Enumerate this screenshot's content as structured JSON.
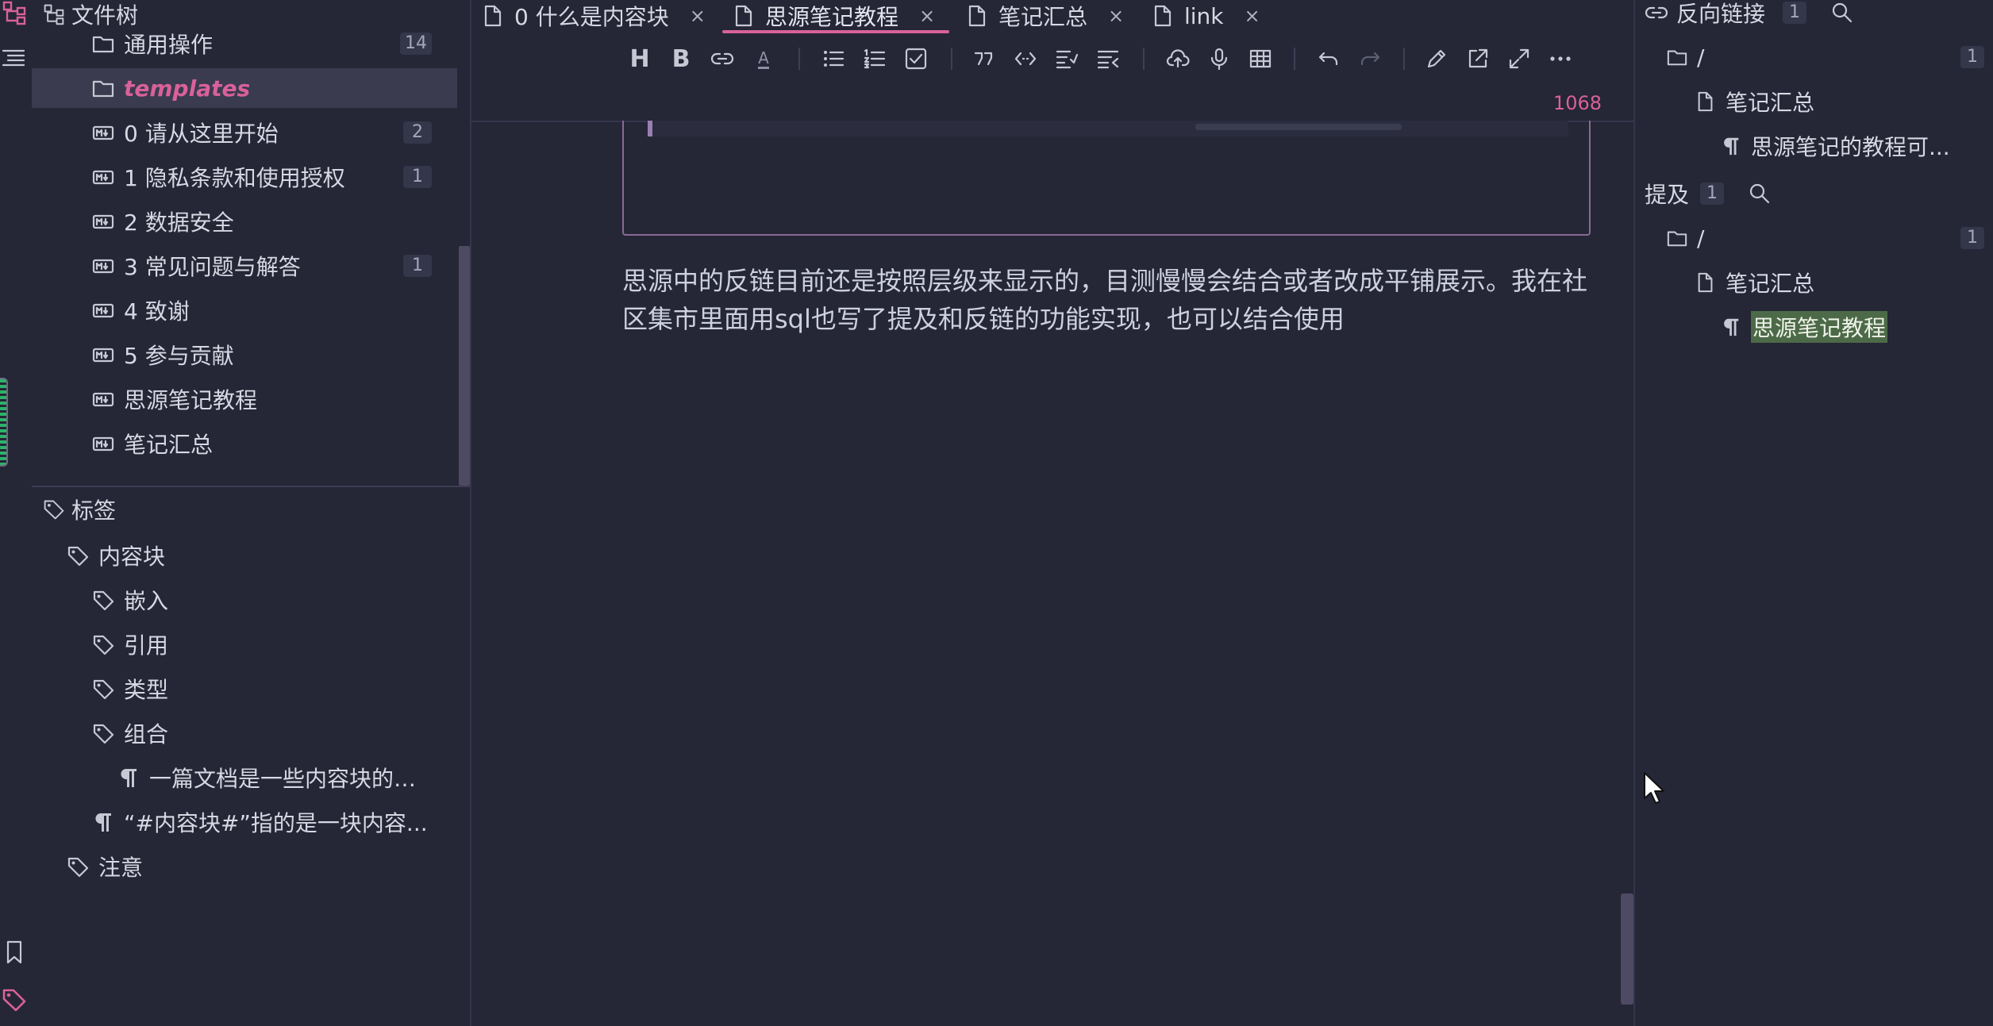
{
  "left_panel": {
    "file_tree_title": "文件树",
    "files": [
      {
        "label": "通用操作",
        "count": "14",
        "icon": "folder-icon"
      },
      {
        "label": "templates",
        "count": "",
        "icon": "folder-icon",
        "selected": true
      },
      {
        "label": "0 请从这里开始",
        "count": "2",
        "icon": "markdown-doc-icon"
      },
      {
        "label": "1 隐私条款和使用授权",
        "count": "1",
        "icon": "markdown-doc-icon"
      },
      {
        "label": "2 数据安全",
        "count": "",
        "icon": "markdown-doc-icon"
      },
      {
        "label": "3 常见问题与解答",
        "count": "1",
        "icon": "markdown-doc-icon"
      },
      {
        "label": "4 致谢",
        "count": "",
        "icon": "markdown-doc-icon"
      },
      {
        "label": "5 参与贡献",
        "count": "",
        "icon": "markdown-doc-icon"
      },
      {
        "label": "思源笔记教程",
        "count": "",
        "icon": "markdown-doc-icon"
      },
      {
        "label": "笔记汇总",
        "count": "",
        "icon": "markdown-doc-icon"
      }
    ],
    "tags_title": "标签",
    "tags": [
      {
        "label": "内容块",
        "icon": "tag-icon"
      },
      {
        "label": "嵌入",
        "icon": "tag-icon"
      },
      {
        "label": "引用",
        "icon": "tag-icon"
      },
      {
        "label": "类型",
        "icon": "tag-icon"
      },
      {
        "label": "组合",
        "icon": "tag-icon"
      },
      {
        "label": "一篇文档是一些内容块的组...",
        "icon": "paragraph-icon"
      },
      {
        "label": "“#内容块#”指的是一块内容...",
        "icon": "paragraph-icon"
      },
      {
        "label": "注意",
        "icon": "tag-icon"
      }
    ]
  },
  "tabs": [
    {
      "label": "0 什么是内容块",
      "close": "×"
    },
    {
      "label": "思源笔记教程",
      "close": "×",
      "active": true
    },
    {
      "label": "笔记汇总",
      "close": "×"
    },
    {
      "label": "link",
      "close": "×"
    }
  ],
  "toolbar": {
    "heading": "H",
    "bold": "B",
    "font_color": "A",
    "icons": [
      "heading-icon",
      "bold-icon",
      "link-icon",
      "font-color-icon",
      "bullet-list-icon",
      "ordered-list-icon",
      "checklist-icon",
      "quote-icon",
      "inline-code-icon",
      "indent-icon",
      "outdent-icon",
      "upload-icon",
      "record-icon",
      "table-icon",
      "undo-icon",
      "redo-icon",
      "edit-icon",
      "open-new-window-icon",
      "fullscreen-icon",
      "more-icon"
    ]
  },
  "editor": {
    "word_count": "1068",
    "paragraph": "思源中的反链目前还是按照层级来显示的，目测慢慢会结合或者改成平铺展示。我在社区集市里面用sql也写了提及和反链的功能实现，也可以结合使用"
  },
  "right_panel": {
    "backlinks_title": "反向链接",
    "backlinks_count": "1",
    "backlinks": [
      {
        "label": "/",
        "count": "1",
        "icon": "folder-icon"
      },
      {
        "label": "笔记汇总",
        "icon": "doc-icon"
      },
      {
        "label": "思源笔记的教程可...",
        "icon": "paragraph-icon"
      }
    ],
    "mentions_title": "提及",
    "mentions_count": "1",
    "mentions": [
      {
        "label": "/",
        "count": "1",
        "icon": "folder-icon"
      },
      {
        "label": "笔记汇总",
        "icon": "doc-icon"
      },
      {
        "label": "思源笔记教程",
        "icon": "paragraph-icon",
        "highlight": true
      }
    ]
  },
  "colors": {
    "background": "#252636",
    "accent": "#d9619a",
    "highlight": "#4d6a48",
    "selected_row": "#3a3b4e"
  }
}
